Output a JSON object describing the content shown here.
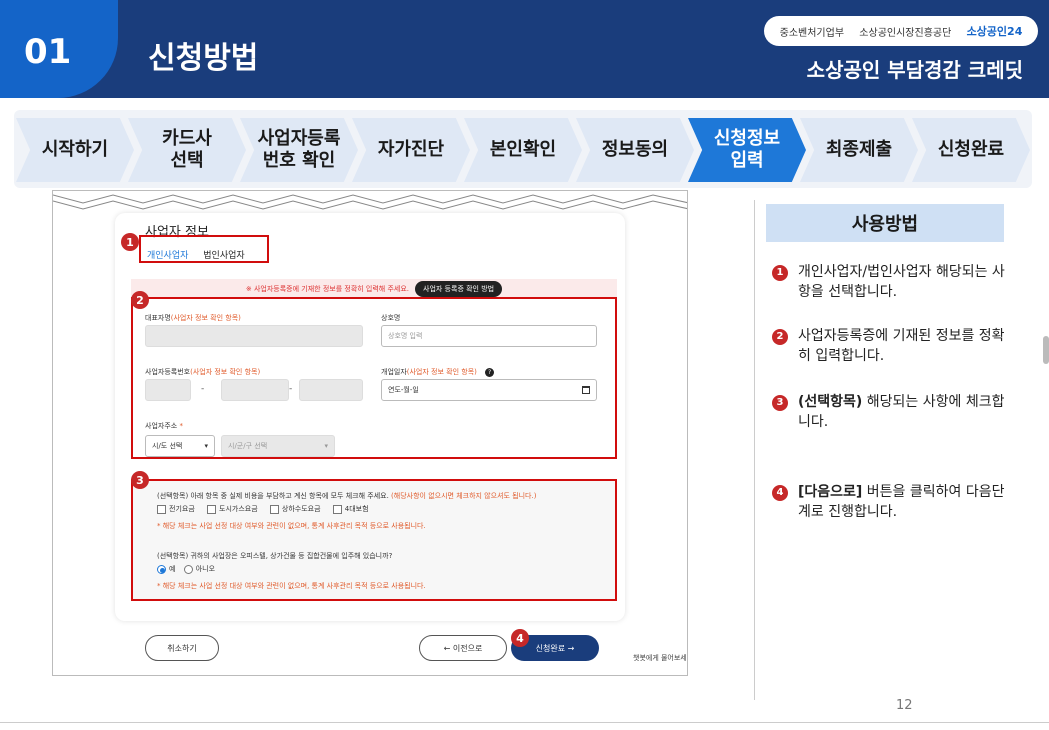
{
  "header": {
    "number": "01",
    "title": "신청방법",
    "logos": [
      "중소벤처기업부",
      "소상공인시장진흥공단",
      "소상공인24"
    ],
    "program": "소상공인 부담경감 크레딧"
  },
  "steps": [
    {
      "label": "시작하기",
      "active": false
    },
    {
      "label": "카드사\n선택",
      "active": false
    },
    {
      "label": "사업자등록\n번호 확인",
      "active": false
    },
    {
      "label": "자가진단",
      "active": false
    },
    {
      "label": "본인확인",
      "active": false
    },
    {
      "label": "정보동의",
      "active": false
    },
    {
      "label": "신청정보\n입력",
      "active": true
    },
    {
      "label": "최종제출",
      "active": false
    },
    {
      "label": "신청완료",
      "active": false
    }
  ],
  "form": {
    "section_title": "사업자 정보",
    "tab_individual": "개인사업자",
    "tab_corporate": "법인사업자",
    "warning": "※ 사업자등록증에 기재한 정보를 정확히 입력해 주세요.",
    "verify_button": "사업자 등록증 확인 방법",
    "rep_name_label": "대표자명",
    "rep_name_hint": "(사업자 정보 확인 항목)",
    "company_label": "상호명",
    "company_placeholder": "상호명 입력",
    "bizno_label": "사업자등록번호",
    "bizno_hint": "(사업자 정보 확인 항목)",
    "dash": "-",
    "opendate_label": "개업일자",
    "opendate_hint": "(사업자 정보 확인 항목)",
    "opendate_value": "연도-월-일",
    "address_label": "사업자주소",
    "required_mark": "*",
    "sido": "시/도 선택",
    "sigungu": "시/군/구 선택",
    "opt1_text": "(선택항목) 아래 항목 중 실제 비용을 부담하고 계신 항목에 모두 체크해 주세요.",
    "opt1_hint": "(해당사항이 없으시면 체크하지 않으셔도 됩니다.)",
    "checks": [
      "전기요금",
      "도시가스요금",
      "상하수도요금",
      "4대보험"
    ],
    "note": "* 해당 체크는 사업 선정 대상 여부와 관련이 없으며, 통계 사후관리 목적 등으로 사용됩니다.",
    "opt2_text": "(선택항목) 귀하의 사업장은 오피스텔, 상가건물 등 집합건물에 입주해 있습니까?",
    "radio_yes": "예",
    "radio_no": "아니오",
    "cancel": "취소하기",
    "prev": "← 이전으로",
    "submit": "신청완료 →",
    "chatbot": "챗봇에게 물어보세"
  },
  "badges": [
    "1",
    "2",
    "3",
    "4"
  ],
  "howto": {
    "title": "사용방법",
    "items": [
      {
        "num": "1",
        "bold": "",
        "text": "개인사업자/법인사업자 해당되는 사항을 선택합니다."
      },
      {
        "num": "2",
        "bold": "",
        "text": "사업자등록증에 기재된 정보를 정확히 입력합니다."
      },
      {
        "num": "3",
        "bold": "(선택항목)",
        "text": " 해당되는 사항에 체크합니다."
      },
      {
        "num": "4",
        "bold": "[다음으로]",
        "text": " 버튼을 클릭하여 다음단계로 진행합니다."
      }
    ]
  },
  "page_number": "12",
  "colors": {
    "navy": "#1a3d7c",
    "blue": "#1464c8",
    "red": "#c62828",
    "step_active": "#1e78d8"
  }
}
